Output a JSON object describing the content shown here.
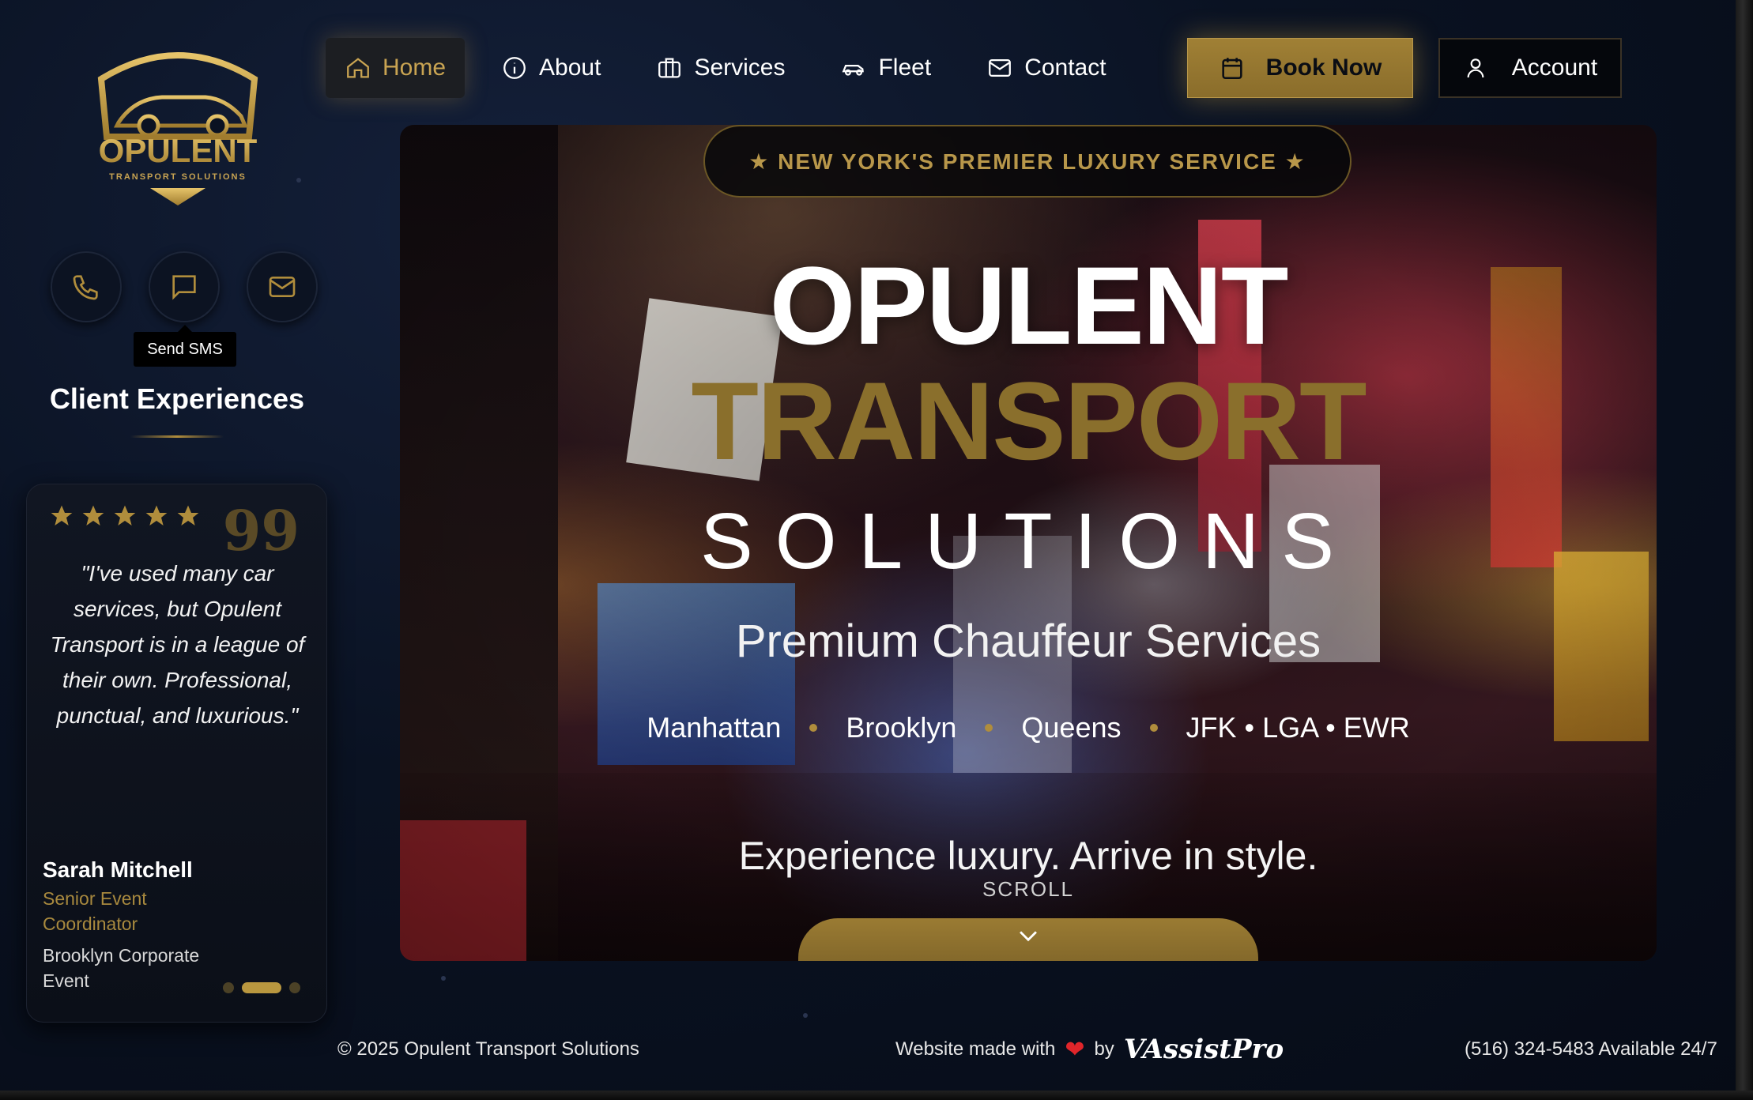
{
  "brand": {
    "logo_name": "OPULENT",
    "logo_sub": "TRANSPORT SOLUTIONS",
    "accent": "#b08d3c"
  },
  "nav": {
    "items": [
      {
        "label": "Home",
        "icon": "home-icon",
        "active": true
      },
      {
        "label": "About",
        "icon": "info-icon"
      },
      {
        "label": "Services",
        "icon": "briefcase-icon"
      },
      {
        "label": "Fleet",
        "icon": "car-icon"
      },
      {
        "label": "Contact",
        "icon": "mail-icon"
      }
    ],
    "book_label": "Book Now",
    "account_label": "Account"
  },
  "sidebar": {
    "contact_buttons": [
      "phone-icon",
      "sms-icon",
      "mail-icon"
    ],
    "tooltip": "Send SMS",
    "section_title": "Client Experiences",
    "testimonial": {
      "stars": 5,
      "quote_mark": "99",
      "quote": "\"I've used many car services, but Opulent Transport is in a league of their own. Professional, punctual, and luxurious.\"",
      "name": "Sarah Mitchell",
      "role": "Senior Event Coordinator",
      "event": "Brooklyn Corporate Event"
    }
  },
  "hero": {
    "badge": "★ NEW YORK'S PREMIER LUXURY SERVICE ★",
    "title_line1": "OPULENT",
    "title_line2": "TRANSPORT",
    "title_line3": "SOLUTIONS",
    "subtitle": "Premium Chauffeur Services",
    "locations": [
      "Manhattan",
      "Brooklyn",
      "Queens",
      "JFK • LGA • EWR"
    ],
    "tagline": "Experience luxury. Arrive in style.",
    "scroll_label": "SCROLL"
  },
  "footer": {
    "copyright": "© 2025 Opulent Transport Solutions",
    "made_with": "Website made with",
    "by": "by",
    "brand": "VAssistPro",
    "phone": "(516) 324-5483 Available 24/7"
  }
}
